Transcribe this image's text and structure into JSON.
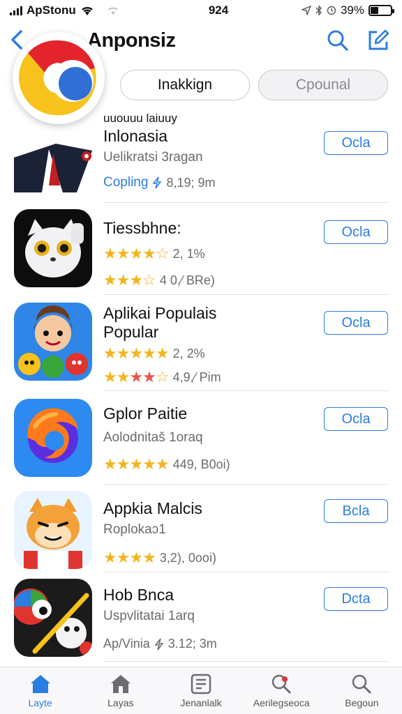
{
  "status_bar": {
    "carrier": "ApStonu",
    "time": "924",
    "battery": "39%",
    "battery_level": 0.39
  },
  "nav": {
    "title": "Anponsiz"
  },
  "tabs": [
    {
      "label": "Inakkign",
      "active": true
    },
    {
      "label": "Cpounal",
      "active": false
    }
  ],
  "apps": [
    {
      "small_heading": "uuouuu laiuuy",
      "name": "Inlonasia",
      "subtitle": "Uelikratsi 3ragan",
      "meta_link": "Copling",
      "meta_text": "8,19; 9m",
      "button": "Ocla"
    },
    {
      "name": "Tiessbhne:",
      "rating_1": "2, 1%",
      "rating_2": "4 0,⁄ BRe)",
      "button": "Ocla"
    },
    {
      "name": "Aplikai Populais",
      "name_line2": "Popular",
      "rating_1": "2, 2%",
      "rating_2": "4,9,⁄ Pim",
      "button": "Ocla"
    },
    {
      "name": "Gplor Paitie",
      "subtitle": "Aolodnitaš 1oraq",
      "rating_1": "449, B0oi)",
      "button": "Ocla"
    },
    {
      "name": "Appkia Malcis",
      "subtitle": "Roplokaɔ1",
      "rating_1": "3,2), 0ooi)",
      "button": "Bcla"
    },
    {
      "name": "Hob Bnca",
      "subtitle": "Uspvlitatai 1arq",
      "meta_text_pre": "Ap/Vinia",
      "meta_text": "3.12; 3m",
      "button": "Dcta"
    }
  ],
  "tab_bar": [
    {
      "label": "Layte",
      "icon": "home-icon",
      "active": true
    },
    {
      "label": "Layas",
      "icon": "home-icon",
      "active": false
    },
    {
      "label": "Jenanlalk",
      "icon": "list-icon",
      "active": false
    },
    {
      "label": "Aerilegseoca",
      "icon": "search-icon",
      "active": false
    },
    {
      "label": "Begoun",
      "icon": "search-icon",
      "active": false
    }
  ],
  "colors": {
    "accent": "#2a7de1",
    "star": "#f2b51d"
  }
}
